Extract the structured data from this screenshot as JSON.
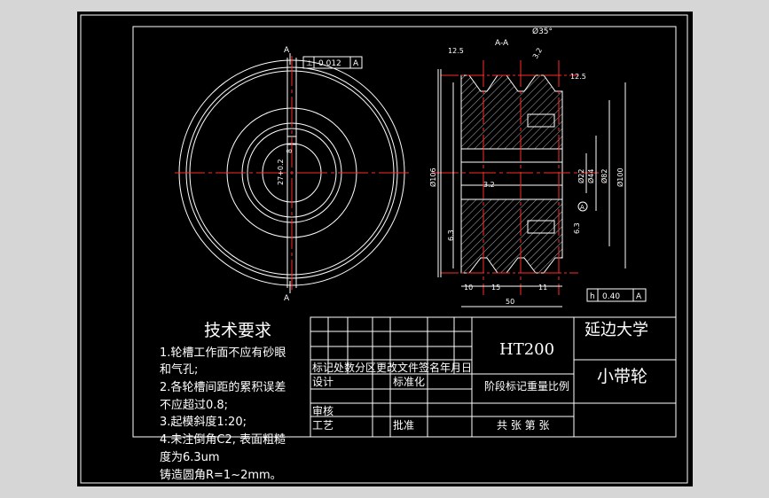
{
  "drawing": {
    "section_label": "A-A",
    "cut_label_top": "A",
    "cut_label_bottom": "A",
    "angle": "Ø35°",
    "tolerance_top": {
      "symbol": "⊥",
      "value": "0.012",
      "datum": "A"
    },
    "tolerance_bottom": {
      "symbol": "h",
      "value": "0.40",
      "datum": "A"
    },
    "roughness": [
      "12.5",
      "3.2",
      "12.5",
      "3.2",
      "6.3",
      "6.3"
    ],
    "keyway": "27+0.2",
    "keyway2": "8",
    "diameters": [
      "Ø106",
      "Ø22",
      "Ø44",
      "Ø82",
      "Ø100"
    ],
    "widths": [
      "10",
      "15",
      "11"
    ],
    "overall_width": "50",
    "datum_mark": "A"
  },
  "tech_requirements": {
    "title": "技术要求",
    "lines": [
      "1.轮槽工作面不应有砂眼",
      "和气孔;",
      "2.各轮槽间距的累积误差",
      "不应超过0.8;",
      "3.起模斜度1:20;",
      "4.未注倒角C2, 表面粗糙",
      "度为6.3um",
      "铸造圆角R=1~2mm。"
    ]
  },
  "title_block": {
    "material": "HT200",
    "school": "延边大学",
    "part_name": "小带轮",
    "row_header": "标记处数分区更改文件签名年月日",
    "design": "设计",
    "standardize": "标准化",
    "stage": "阶段标记重量比例",
    "review": "审核",
    "process": "工艺",
    "approve": "批准",
    "sheets": "共 张 第 张"
  }
}
